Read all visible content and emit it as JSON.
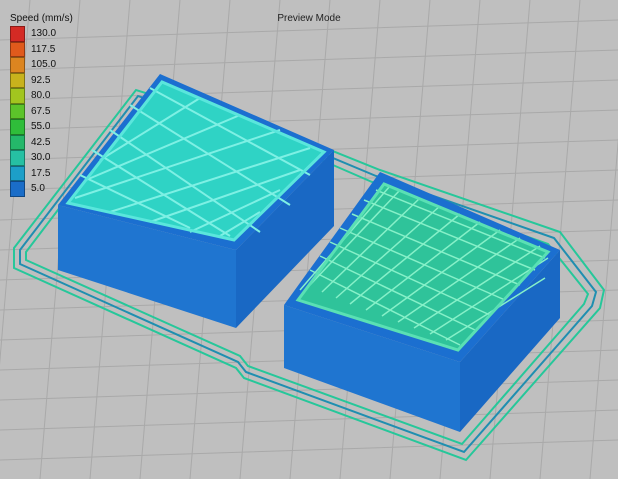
{
  "viewer": {
    "mode_title": "Preview Mode",
    "legend_title": "Speed (mm/s)"
  },
  "legend": [
    {
      "label": "130.0",
      "color": "#d42a24"
    },
    {
      "label": "117.5",
      "color": "#e05a1c"
    },
    {
      "label": "105.0",
      "color": "#dc8520"
    },
    {
      "label": "92.5",
      "color": "#c8b21c"
    },
    {
      "label": "80.0",
      "color": "#a2c51f"
    },
    {
      "label": "67.5",
      "color": "#5cc42a"
    },
    {
      "label": "55.0",
      "color": "#2fbd3a"
    },
    {
      "label": "42.5",
      "color": "#24b86a"
    },
    {
      "label": "30.0",
      "color": "#26c0a3"
    },
    {
      "label": "17.5",
      "color": "#1c9fc8"
    },
    {
      "label": "5.0",
      "color": "#1a6dc8"
    }
  ],
  "colors": {
    "background": "#bfbfbf",
    "grid": "#a8a8a8",
    "wall": "#1a6dc8",
    "top_infill_left": "#2fd3c5",
    "top_infill_right": "#2fc39a",
    "skirt": "#26c79a"
  }
}
